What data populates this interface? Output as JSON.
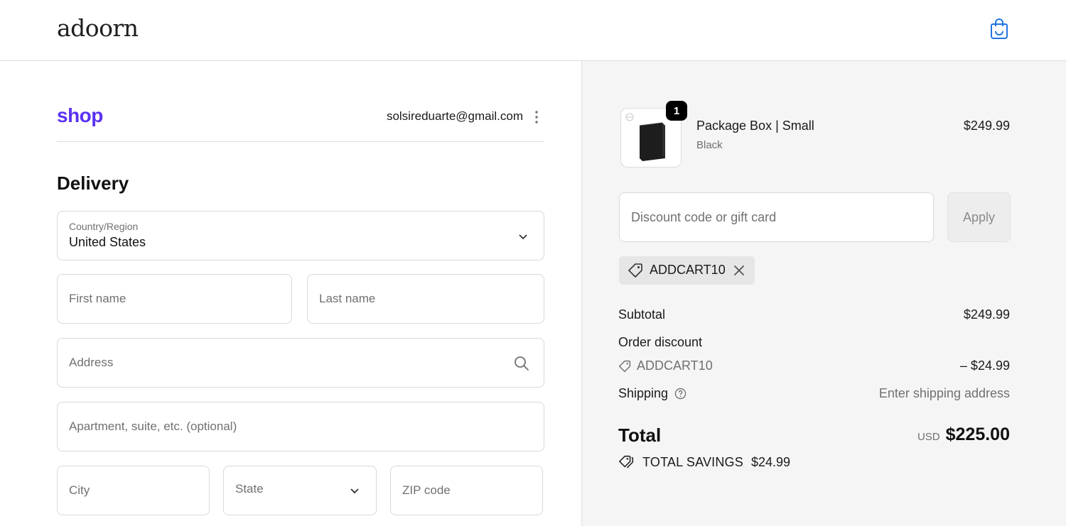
{
  "header": {
    "brand": "adoorn",
    "cart_icon": "shopping-bag-icon",
    "accent": "#1f74e0"
  },
  "account": {
    "shop_logo": "shop",
    "shop_color": "#5a31f4",
    "email": "solsireduarte@gmail.com",
    "menu_icon": "kebab-icon"
  },
  "delivery": {
    "title": "Delivery",
    "country_label": "Country/Region",
    "country_value": "United States",
    "first_name_placeholder": "First name",
    "last_name_placeholder": "Last name",
    "address_placeholder": "Address",
    "apartment_placeholder": "Apartment, suite, etc. (optional)",
    "city_placeholder": "City",
    "state_placeholder": "State",
    "zip_placeholder": "ZIP code"
  },
  "summary": {
    "product": {
      "name": "Package Box | Small",
      "variant": "Black",
      "price": "$249.99",
      "quantity": "1"
    },
    "discount_placeholder": "Discount code or gift card",
    "apply_label": "Apply",
    "applied_code": "ADDCART10",
    "subtotal_label": "Subtotal",
    "subtotal_value": "$249.99",
    "order_discount_label": "Order discount",
    "discount_code": "ADDCART10",
    "discount_value": "– $24.99",
    "shipping_label": "Shipping",
    "shipping_value": "Enter shipping address",
    "total_label": "Total",
    "total_currency": "USD",
    "total_value": "$225.00",
    "savings_label": "TOTAL SAVINGS",
    "savings_value": "$24.99"
  }
}
